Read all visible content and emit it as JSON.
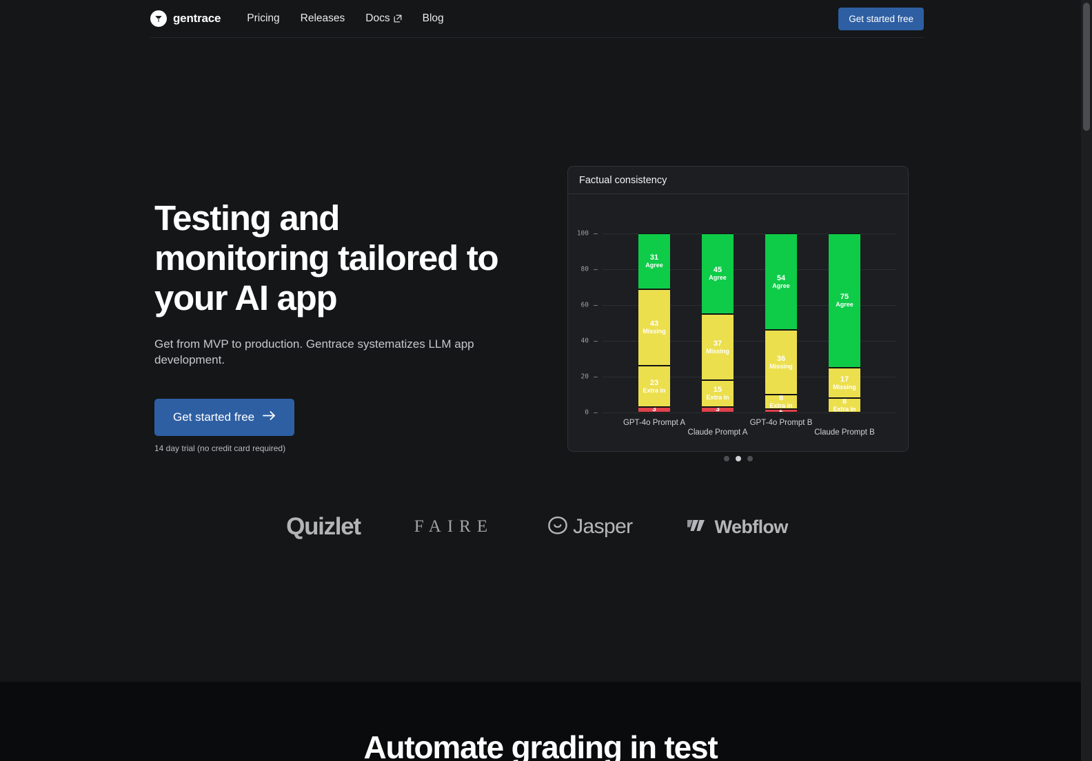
{
  "header": {
    "brand": "gentrace",
    "brand_logo_icon": "funnel-icon",
    "nav": [
      {
        "label": "Pricing",
        "external": false
      },
      {
        "label": "Releases",
        "external": false
      },
      {
        "label": "Docs",
        "external": true
      },
      {
        "label": "Blog",
        "external": false
      }
    ],
    "cta_label": "Get started free"
  },
  "hero": {
    "title": "Testing and monitoring tailored to your AI app",
    "subtitle": "Get from MVP to production. Gentrace systematizes LLM app development.",
    "cta_label": "Get started free",
    "cta_arrow": "arrow-right-icon",
    "note": "14 day trial (no credit card required)"
  },
  "carousel": {
    "dots": 3,
    "active_index": 1
  },
  "chart_data": {
    "type": "bar",
    "stacked": true,
    "title": "Factual consistency",
    "xlabel": "",
    "ylabel": "",
    "ylim": [
      0,
      100
    ],
    "yticks": [
      0,
      20,
      40,
      60,
      80,
      100
    ],
    "grid": true,
    "legend": "none",
    "categories": [
      "GPT-4o Prompt A",
      "Claude Prompt A",
      "GPT-4o Prompt B",
      "Claude Prompt B"
    ],
    "colors": {
      "agree": "#0ecc48",
      "missing": "#ecdf4e",
      "extra_in": "#ecdf4e",
      "disagree": "#e0434c"
    },
    "series": [
      {
        "name": "Agree",
        "values": [
          31,
          45,
          54,
          75
        ]
      },
      {
        "name": "Missing",
        "values": [
          43,
          37,
          36,
          17
        ]
      },
      {
        "name": "Extra in",
        "values": [
          23,
          15,
          8,
          8
        ]
      },
      {
        "name": "",
        "values": [
          3,
          3,
          2,
          0
        ]
      }
    ],
    "bars": [
      {
        "category": "GPT-4o Prompt A",
        "segments": [
          {
            "value": 31,
            "label": "Agree",
            "color": "#0ecc48"
          },
          {
            "value": 43,
            "label": "Missing",
            "color": "#ecdf4e"
          },
          {
            "value": 23,
            "label": "Extra in",
            "color": "#ecdf4e"
          },
          {
            "value": 3,
            "label": "",
            "color": "#e0434c"
          }
        ]
      },
      {
        "category": "Claude Prompt A",
        "segments": [
          {
            "value": 45,
            "label": "Agree",
            "color": "#0ecc48"
          },
          {
            "value": 37,
            "label": "Missing",
            "color": "#ecdf4e"
          },
          {
            "value": 15,
            "label": "Extra in",
            "color": "#ecdf4e"
          },
          {
            "value": 3,
            "label": "",
            "color": "#e0434c"
          }
        ]
      },
      {
        "category": "GPT-4o Prompt B",
        "segments": [
          {
            "value": 54,
            "label": "Agree",
            "color": "#0ecc48"
          },
          {
            "value": 36,
            "label": "Missing",
            "color": "#ecdf4e"
          },
          {
            "value": 8,
            "label": "Extra in",
            "color": "#ecdf4e"
          },
          {
            "value": 2,
            "label": "",
            "color": "#e0434c"
          }
        ]
      },
      {
        "category": "Claude Prompt B",
        "segments": [
          {
            "value": 75,
            "label": "Agree",
            "color": "#0ecc48"
          },
          {
            "value": 17,
            "label": "Missing",
            "color": "#ecdf4e"
          },
          {
            "value": 8,
            "label": "Extra in",
            "color": "#ecdf4e"
          }
        ]
      }
    ]
  },
  "logos": [
    {
      "name": "Quizlet"
    },
    {
      "name": "FAIRE"
    },
    {
      "name": "Jasper"
    },
    {
      "name": "Webflow"
    }
  ],
  "next_section": {
    "title": "Automate grading in test"
  }
}
